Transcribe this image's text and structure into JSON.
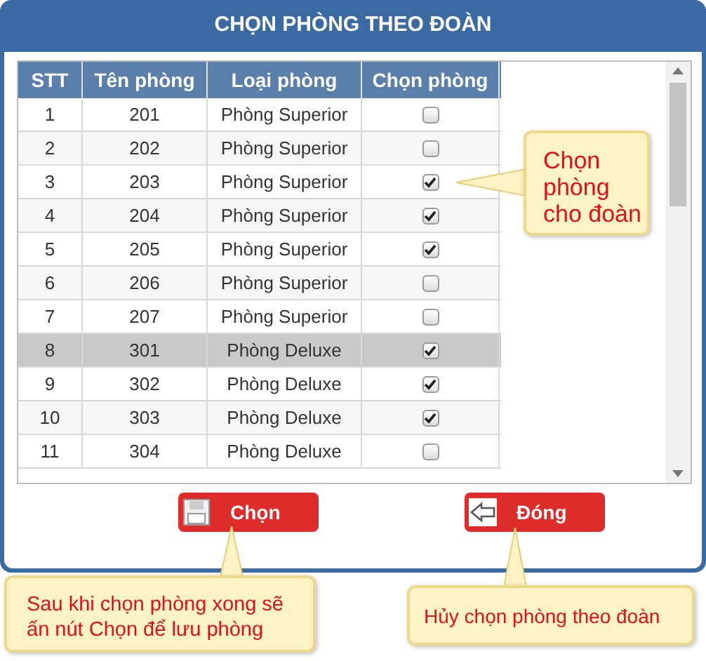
{
  "dialog": {
    "title": "CHỌN PHÒNG THEO ĐOÀN"
  },
  "table": {
    "columns": [
      "STT",
      "Tên phòng",
      "Loại phòng",
      "Chọn phòng"
    ],
    "rows": [
      {
        "stt": "1",
        "room": "201",
        "type": "Phòng Superior",
        "checked": false,
        "selected": false
      },
      {
        "stt": "2",
        "room": "202",
        "type": "Phòng Superior",
        "checked": false,
        "selected": false
      },
      {
        "stt": "3",
        "room": "203",
        "type": "Phòng Superior",
        "checked": true,
        "selected": false
      },
      {
        "stt": "4",
        "room": "204",
        "type": "Phòng Superior",
        "checked": true,
        "selected": false
      },
      {
        "stt": "5",
        "room": "205",
        "type": "Phòng Superior",
        "checked": true,
        "selected": false
      },
      {
        "stt": "6",
        "room": "206",
        "type": "Phòng Superior",
        "checked": false,
        "selected": false
      },
      {
        "stt": "7",
        "room": "207",
        "type": "Phòng Superior",
        "checked": false,
        "selected": false
      },
      {
        "stt": "8",
        "room": "301",
        "type": "Phòng Deluxe",
        "checked": true,
        "selected": true
      },
      {
        "stt": "9",
        "room": "302",
        "type": "Phòng Deluxe",
        "checked": true,
        "selected": false
      },
      {
        "stt": "10",
        "room": "303",
        "type": "Phòng Deluxe",
        "checked": true,
        "selected": false
      },
      {
        "stt": "11",
        "room": "304",
        "type": "Phòng Deluxe",
        "checked": false,
        "selected": false
      }
    ]
  },
  "buttons": [
    {
      "label": "Chọn",
      "kind": "save"
    },
    {
      "label": "Đóng",
      "kind": "close"
    }
  ],
  "callouts": [
    {
      "text": "Chọn phòng cho đoàn",
      "kind": "table"
    },
    {
      "text": "Sau khi chọn phòng xong sẽ ấn nút Chọn để lưu phòng",
      "kind": "save"
    },
    {
      "text": "Hủy chọn phòng theo đoàn",
      "kind": "close"
    }
  ]
}
